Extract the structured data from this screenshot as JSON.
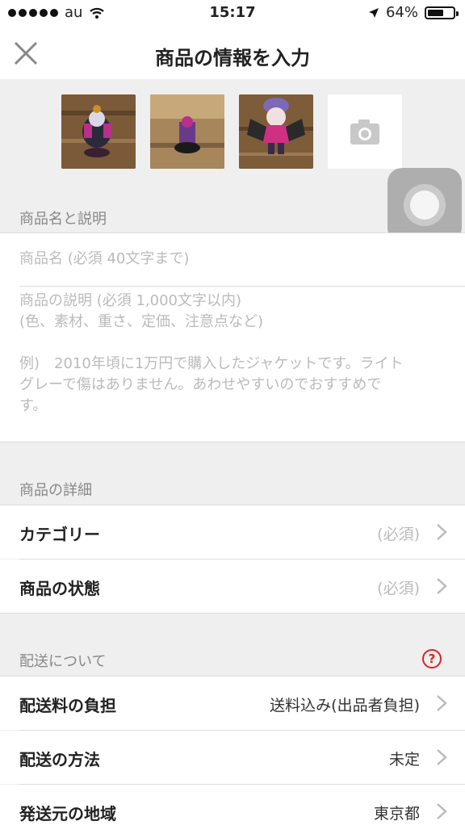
{
  "status": {
    "carrier": "au",
    "time": "15:17",
    "battery": "64%",
    "battery_level": 0.64
  },
  "nav": {
    "title": "商品の情報を入力"
  },
  "photos": {
    "count": 3
  },
  "sections": {
    "name_desc": {
      "header": "商品名と説明"
    },
    "details": {
      "header": "商品の詳細"
    },
    "shipping": {
      "header": "配送について"
    }
  },
  "inputs": {
    "name_placeholder": "商品名 (必須 40文字まで)",
    "desc_placeholder_line1": "商品の説明 (必須 1,000文字以内)",
    "desc_placeholder_line2": "(色、素材、重さ、定価、注意点など)",
    "desc_example_line1": "例)　2010年頃に1万円で購入したジャケットです。ライト",
    "desc_example_line2": "グレーで傷はありません。あわせやすいのでおすすめで",
    "desc_example_line3": "す。"
  },
  "details": {
    "category": {
      "label": "カテゴリー",
      "value": "(必須)"
    },
    "condition": {
      "label": "商品の状態",
      "value": "(必須)"
    }
  },
  "shipping": {
    "fee": {
      "label": "配送料の負担",
      "value": "送料込み(出品者負担)"
    },
    "method": {
      "label": "配送の方法",
      "value": "未定"
    },
    "origin": {
      "label": "発送元の地域",
      "value": "東京都"
    }
  },
  "colors": {
    "accent": "#e02020",
    "background": "#efefef",
    "placeholder": "#bbbbbb"
  }
}
